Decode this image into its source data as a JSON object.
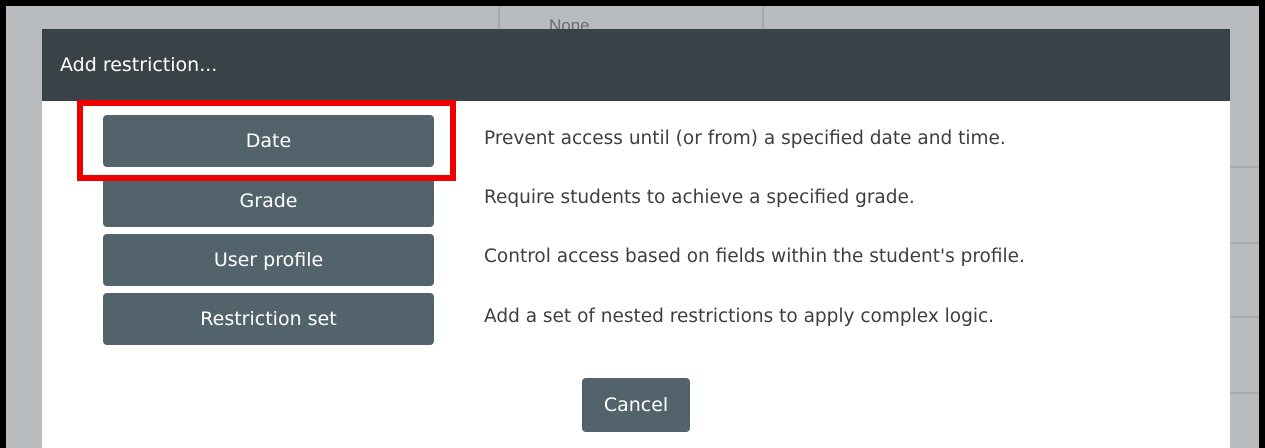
{
  "background": {
    "cell_text": "None"
  },
  "dialog": {
    "title": "Add restriction...",
    "options": [
      {
        "label": "Date",
        "description": "Prevent access until (or from) a specified date and time.",
        "highlighted": true
      },
      {
        "label": "Grade",
        "description": "Require students to achieve a specified grade.",
        "highlighted": false
      },
      {
        "label": "User profile",
        "description": "Control access based on fields within the student's profile.",
        "highlighted": false
      },
      {
        "label": "Restriction set",
        "description": "Add a set of nested restrictions to apply complex logic.",
        "highlighted": false
      }
    ],
    "cancel_label": "Cancel"
  },
  "colors": {
    "header_bg": "#394247",
    "button_bg": "#52636b",
    "highlight": "#ef0000",
    "backdrop": "#b9bcbe"
  }
}
